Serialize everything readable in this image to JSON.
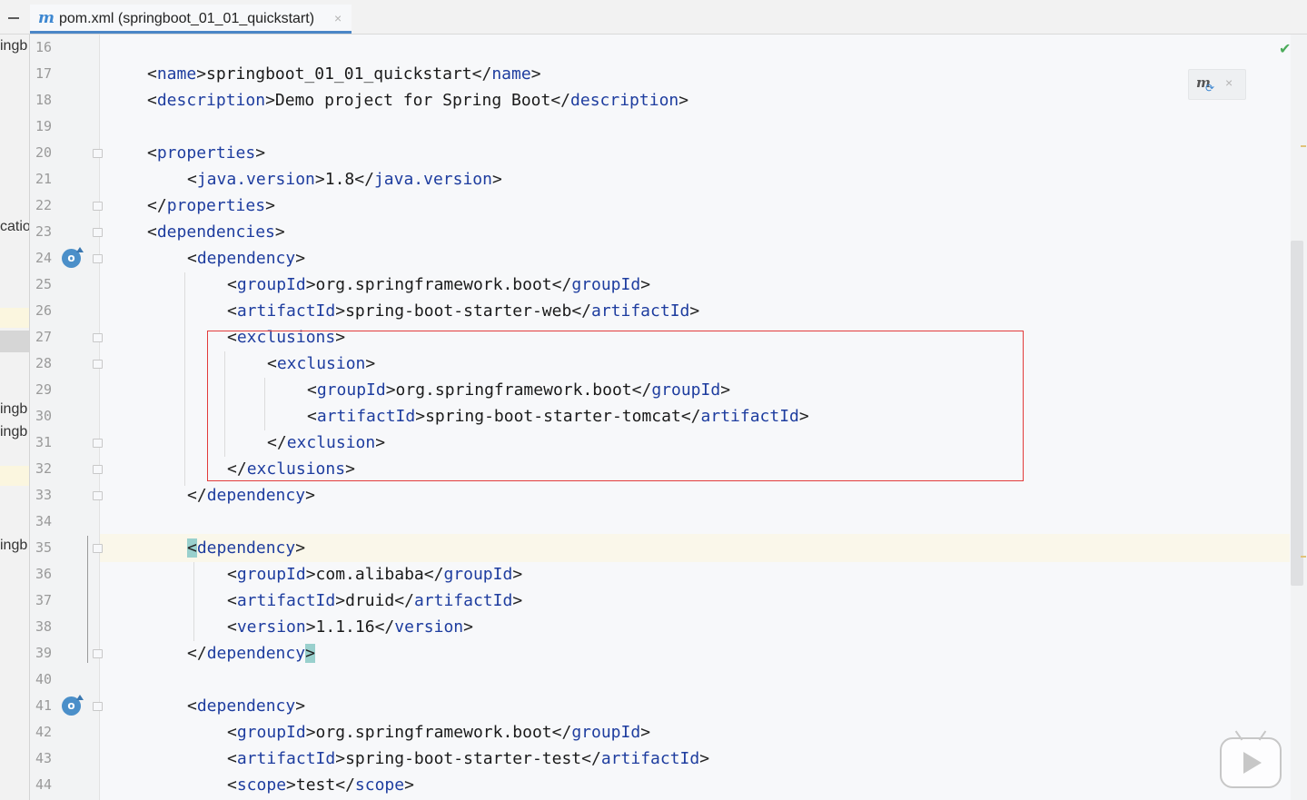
{
  "tab": {
    "icon": "maven-m-icon",
    "label": "pom.xml (springboot_01_01_quickstart)",
    "close": "×"
  },
  "project_panel": {
    "fragments": [
      "ingb",
      "catio",
      "ingb",
      "ingb",
      "ingb"
    ]
  },
  "editor": {
    "status_icon": "✔",
    "maven_popup_close": "×",
    "lines": [
      {
        "num": "16",
        "indent": 0,
        "parts": []
      },
      {
        "num": "17",
        "indent": 1,
        "parts": [
          [
            "br",
            "<"
          ],
          [
            "tag",
            "name"
          ],
          [
            "br",
            ">"
          ],
          [
            "txt",
            "springboot_01_01_quickstart"
          ],
          [
            "br",
            "</"
          ],
          [
            "tag",
            "name"
          ],
          [
            "br",
            ">"
          ]
        ]
      },
      {
        "num": "18",
        "indent": 1,
        "parts": [
          [
            "br",
            "<"
          ],
          [
            "tag",
            "description"
          ],
          [
            "br",
            ">"
          ],
          [
            "txt",
            "Demo project for Spring Boot"
          ],
          [
            "br",
            "</"
          ],
          [
            "tag",
            "description"
          ],
          [
            "br",
            ">"
          ]
        ]
      },
      {
        "num": "19",
        "indent": 0,
        "parts": []
      },
      {
        "num": "20",
        "indent": 1,
        "parts": [
          [
            "br",
            "<"
          ],
          [
            "tag",
            "properties"
          ],
          [
            "br",
            ">"
          ]
        ]
      },
      {
        "num": "21",
        "indent": 2,
        "parts": [
          [
            "br",
            "<"
          ],
          [
            "tag",
            "java.version"
          ],
          [
            "br",
            ">"
          ],
          [
            "txt",
            "1.8"
          ],
          [
            "br",
            "</"
          ],
          [
            "tag",
            "java.version"
          ],
          [
            "br",
            ">"
          ]
        ]
      },
      {
        "num": "22",
        "indent": 1,
        "parts": [
          [
            "br",
            "</"
          ],
          [
            "tag",
            "properties"
          ],
          [
            "br",
            ">"
          ]
        ]
      },
      {
        "num": "23",
        "indent": 1,
        "parts": [
          [
            "br",
            "<"
          ],
          [
            "tag",
            "dependencies"
          ],
          [
            "br",
            ">"
          ]
        ]
      },
      {
        "num": "24",
        "indent": 2,
        "parts": [
          [
            "br",
            "<"
          ],
          [
            "tag",
            "dependency"
          ],
          [
            "br",
            ">"
          ]
        ]
      },
      {
        "num": "25",
        "indent": 3,
        "parts": [
          [
            "br",
            "<"
          ],
          [
            "tag",
            "groupId"
          ],
          [
            "br",
            ">"
          ],
          [
            "txt",
            "org.springframework.boot"
          ],
          [
            "br",
            "</"
          ],
          [
            "tag",
            "groupId"
          ],
          [
            "br",
            ">"
          ]
        ]
      },
      {
        "num": "26",
        "indent": 3,
        "parts": [
          [
            "br",
            "<"
          ],
          [
            "tag",
            "artifactId"
          ],
          [
            "br",
            ">"
          ],
          [
            "txt",
            "spring-boot-starter-web"
          ],
          [
            "br",
            "</"
          ],
          [
            "tag",
            "artifactId"
          ],
          [
            "br",
            ">"
          ]
        ]
      },
      {
        "num": "27",
        "indent": 3,
        "parts": [
          [
            "br",
            "<"
          ],
          [
            "tag",
            "exclusions"
          ],
          [
            "br",
            ">"
          ]
        ]
      },
      {
        "num": "28",
        "indent": 4,
        "parts": [
          [
            "br",
            "<"
          ],
          [
            "tag",
            "exclusion"
          ],
          [
            "br",
            ">"
          ]
        ]
      },
      {
        "num": "29",
        "indent": 5,
        "parts": [
          [
            "br",
            "<"
          ],
          [
            "tag",
            "groupId"
          ],
          [
            "br",
            ">"
          ],
          [
            "txt",
            "org.springframework.boot"
          ],
          [
            "br",
            "</"
          ],
          [
            "tag",
            "groupId"
          ],
          [
            "br",
            ">"
          ]
        ]
      },
      {
        "num": "30",
        "indent": 5,
        "parts": [
          [
            "br",
            "<"
          ],
          [
            "tag",
            "artifactId"
          ],
          [
            "br",
            ">"
          ],
          [
            "txt",
            "spring-boot-starter-tomcat"
          ],
          [
            "br",
            "</"
          ],
          [
            "tag",
            "artifactId"
          ],
          [
            "br",
            ">"
          ]
        ]
      },
      {
        "num": "31",
        "indent": 4,
        "parts": [
          [
            "br",
            "</"
          ],
          [
            "tag",
            "exclusion"
          ],
          [
            "br",
            ">"
          ]
        ]
      },
      {
        "num": "32",
        "indent": 3,
        "parts": [
          [
            "br",
            "</"
          ],
          [
            "tag",
            "exclusions"
          ],
          [
            "br",
            ">"
          ]
        ]
      },
      {
        "num": "33",
        "indent": 2,
        "parts": [
          [
            "br",
            "</"
          ],
          [
            "tag",
            "dependency"
          ],
          [
            "br",
            ">"
          ]
        ]
      },
      {
        "num": "34",
        "indent": 0,
        "parts": []
      },
      {
        "num": "35",
        "indent": 2,
        "parts": [
          [
            "match",
            "<"
          ],
          [
            "tag",
            "dependency"
          ],
          [
            "br",
            ">"
          ]
        ]
      },
      {
        "num": "36",
        "indent": 3,
        "parts": [
          [
            "br",
            "<"
          ],
          [
            "tag",
            "groupId"
          ],
          [
            "br",
            ">"
          ],
          [
            "txt",
            "com.alibaba"
          ],
          [
            "br",
            "</"
          ],
          [
            "tag",
            "groupId"
          ],
          [
            "br",
            ">"
          ]
        ]
      },
      {
        "num": "37",
        "indent": 3,
        "parts": [
          [
            "br",
            "<"
          ],
          [
            "tag",
            "artifactId"
          ],
          [
            "br",
            ">"
          ],
          [
            "txt",
            "druid"
          ],
          [
            "br",
            "</"
          ],
          [
            "tag",
            "artifactId"
          ],
          [
            "br",
            ">"
          ]
        ]
      },
      {
        "num": "38",
        "indent": 3,
        "parts": [
          [
            "br",
            "<"
          ],
          [
            "tag",
            "version"
          ],
          [
            "br",
            ">"
          ],
          [
            "txt",
            "1.1.16"
          ],
          [
            "br",
            "</"
          ],
          [
            "tag",
            "version"
          ],
          [
            "br",
            ">"
          ]
        ]
      },
      {
        "num": "39",
        "indent": 2,
        "parts": [
          [
            "br",
            "</"
          ],
          [
            "tag",
            "dependency"
          ],
          [
            "match",
            ">"
          ]
        ]
      },
      {
        "num": "40",
        "indent": 0,
        "parts": []
      },
      {
        "num": "41",
        "indent": 2,
        "parts": [
          [
            "br",
            "<"
          ],
          [
            "tag",
            "dependency"
          ],
          [
            "br",
            ">"
          ]
        ]
      },
      {
        "num": "42",
        "indent": 3,
        "parts": [
          [
            "br",
            "<"
          ],
          [
            "tag",
            "groupId"
          ],
          [
            "br",
            ">"
          ],
          [
            "txt",
            "org.springframework.boot"
          ],
          [
            "br",
            "</"
          ],
          [
            "tag",
            "groupId"
          ],
          [
            "br",
            ">"
          ]
        ]
      },
      {
        "num": "43",
        "indent": 3,
        "parts": [
          [
            "br",
            "<"
          ],
          [
            "tag",
            "artifactId"
          ],
          [
            "br",
            ">"
          ],
          [
            "txt",
            "spring-boot-starter-test"
          ],
          [
            "br",
            "</"
          ],
          [
            "tag",
            "artifactId"
          ],
          [
            "br",
            ">"
          ]
        ]
      },
      {
        "num": "44",
        "indent": 3,
        "parts": [
          [
            "br",
            "<"
          ],
          [
            "tag",
            "scope"
          ],
          [
            "br",
            ">"
          ],
          [
            "txt",
            "test"
          ],
          [
            "br",
            "</"
          ],
          [
            "tag",
            "scope"
          ],
          [
            "br",
            ">"
          ]
        ]
      }
    ]
  },
  "colors": {
    "tag": "#1e3d9f",
    "highlight_box": "#e23b3b",
    "brace_match": "#99d0cd",
    "caret_row": "#faf7ea",
    "tab_underline": "#4a86c7"
  }
}
